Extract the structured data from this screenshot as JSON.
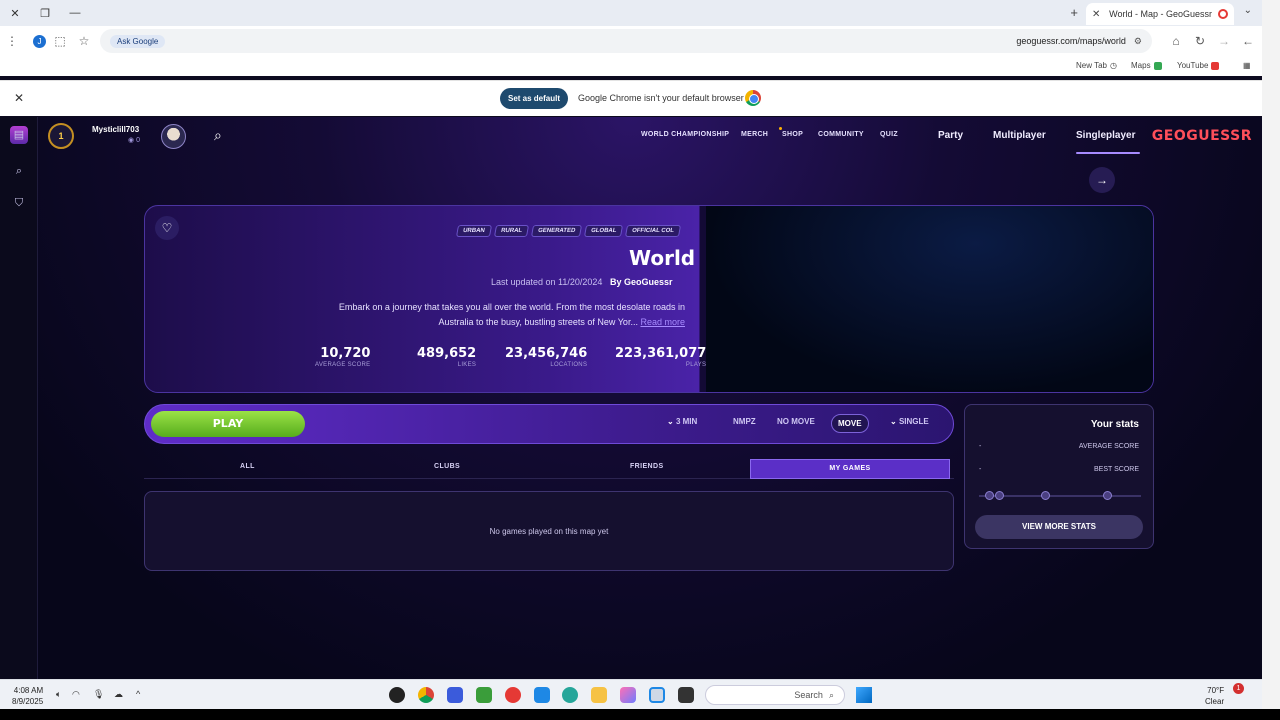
{
  "browser": {
    "tab_title": "World - Map - GeoGuessr",
    "url": "geoguessr.com/maps/world",
    "ask_google": "Ask Google",
    "profile_initial": "J",
    "bookmarks": [
      "YouTube",
      "Maps",
      "New Tab"
    ],
    "infobar_text": "Google Chrome isn't your default browser",
    "set_default_label": "Set as default"
  },
  "nav": {
    "logo": "GEOGUESSR",
    "singleplayer": "Singleplayer",
    "multiplayer": "Multiplayer",
    "party": "Party",
    "quiz": "QUIZ",
    "community": "COMMUNITY",
    "shop": "SHOP",
    "merch": "MERCH",
    "world_championship": "WORLD CHAMPIONSHIP",
    "username": "Mysticlill703",
    "user_level": "0",
    "coin_value": "1"
  },
  "map": {
    "tags": [
      "OFFICIAL COL",
      "GLOBAL",
      "GENERATED",
      "RURAL",
      "URBAN"
    ],
    "title": "World",
    "by_label": "By",
    "author": "GeoGuessr",
    "last_updated": "Last updated on 11/20/2024",
    "description": "Embark on a journey that takes you all over the world. From the most desolate roads in Australia to the busy, bustling streets of New Yor...",
    "read_more": "Read more",
    "stats": [
      {
        "value": "223,361,077",
        "label": "PLAYS"
      },
      {
        "value": "23,456,746",
        "label": "LOCATIONS"
      },
      {
        "value": "489,652",
        "label": "LIKES"
      },
      {
        "value": "10,720",
        "label": "AVERAGE SCORE"
      }
    ]
  },
  "play": {
    "play_label": "PLAY",
    "mode": "SINGLE",
    "move": "MOVE",
    "no_move": "NO MOVE",
    "nmpz": "NMPZ",
    "time": "3 MIN"
  },
  "games_tabs": {
    "my_games": "MY GAMES",
    "friends": "FRIENDS",
    "clubs": "CLUBS",
    "all": "ALL"
  },
  "empty_message": "No games played on this map yet",
  "your_stats": {
    "title": "Your stats",
    "average_score_label": "AVERAGE SCORE",
    "average_score_value": "-",
    "best_score_label": "BEST SCORE",
    "best_score_value": "-",
    "view_more": "VIEW MORE STATS"
  },
  "taskbar": {
    "time": "4:08 AM",
    "date": "8/9/2025",
    "search": "Search",
    "weather_temp": "70°F",
    "weather_text": "Clear",
    "notification_count": "1"
  }
}
